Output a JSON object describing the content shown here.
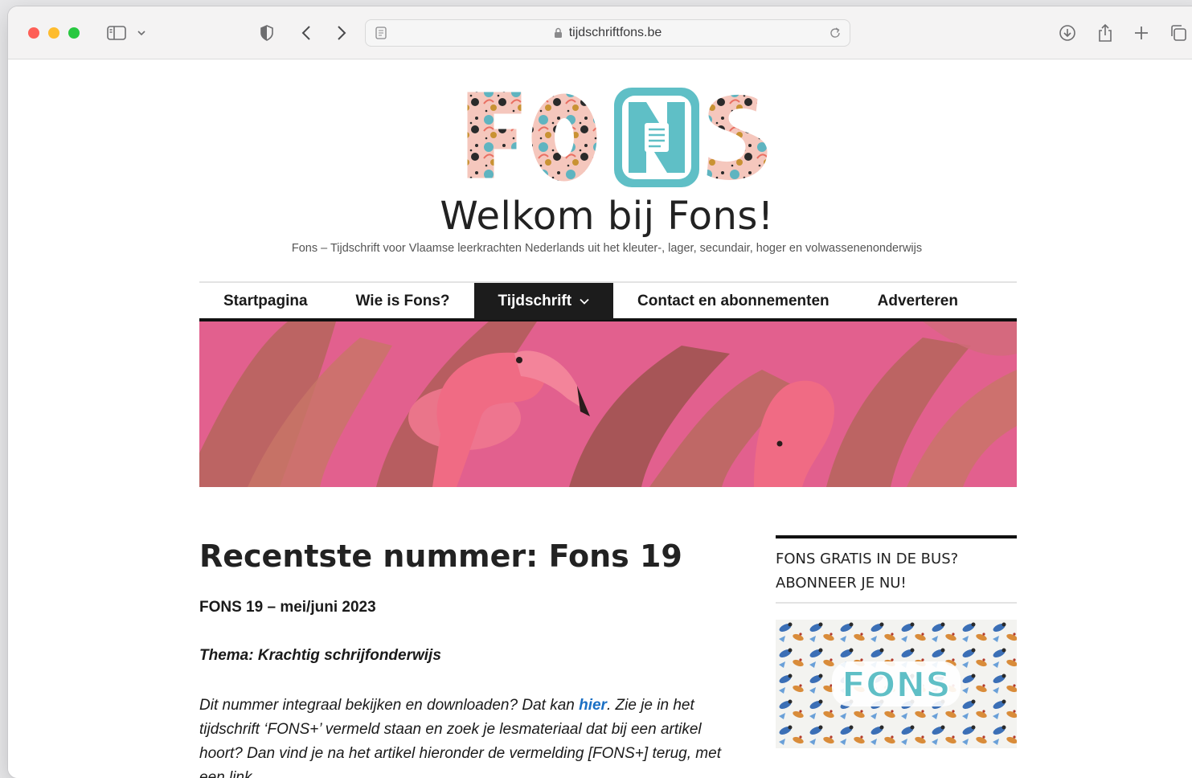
{
  "browser": {
    "url": "tijdschriftfons.be"
  },
  "site": {
    "title": "Welkom bij Fons!",
    "tagline": "Fons – Tijdschrift voor Vlaamse leerkrachten Nederlands uit het kleuter-, lager, secundair, hoger en volwassenenonderwijs",
    "logo_text": "FONS"
  },
  "nav": {
    "items": [
      {
        "label": "Startpagina"
      },
      {
        "label": "Wie is Fons?"
      },
      {
        "label": "Tijdschrift"
      },
      {
        "label": "Contact en abonnementen"
      },
      {
        "label": "Adverteren"
      }
    ],
    "active_index": 2
  },
  "main": {
    "title": "Recentste nummer: Fons 19",
    "issue": "FONS 19 – mei/juni 2023",
    "theme": "Thema: Krachtig schrijfonderwijs",
    "para_before_link": "Dit nummer integraal bekijken en downloaden? Dat kan ",
    "link": "hier",
    "para_after_link": ". Zie je in het tijdschrift ‘FONS+’ vermeld staan en zoek je lesmateriaal dat bij een artikel hoort? Dan vind je na het artikel hieronder de vermelding [FONS+] terug, met een link"
  },
  "sidebar": {
    "widget_title": "FONS GRATIS IN DE BUS? ABONNEER JE NU!",
    "widget_image_text": "FONS"
  },
  "colors": {
    "accent_link": "#1a6fc4",
    "logo_teal": "#5fbfc6",
    "banner_pink": "#e2608e"
  }
}
